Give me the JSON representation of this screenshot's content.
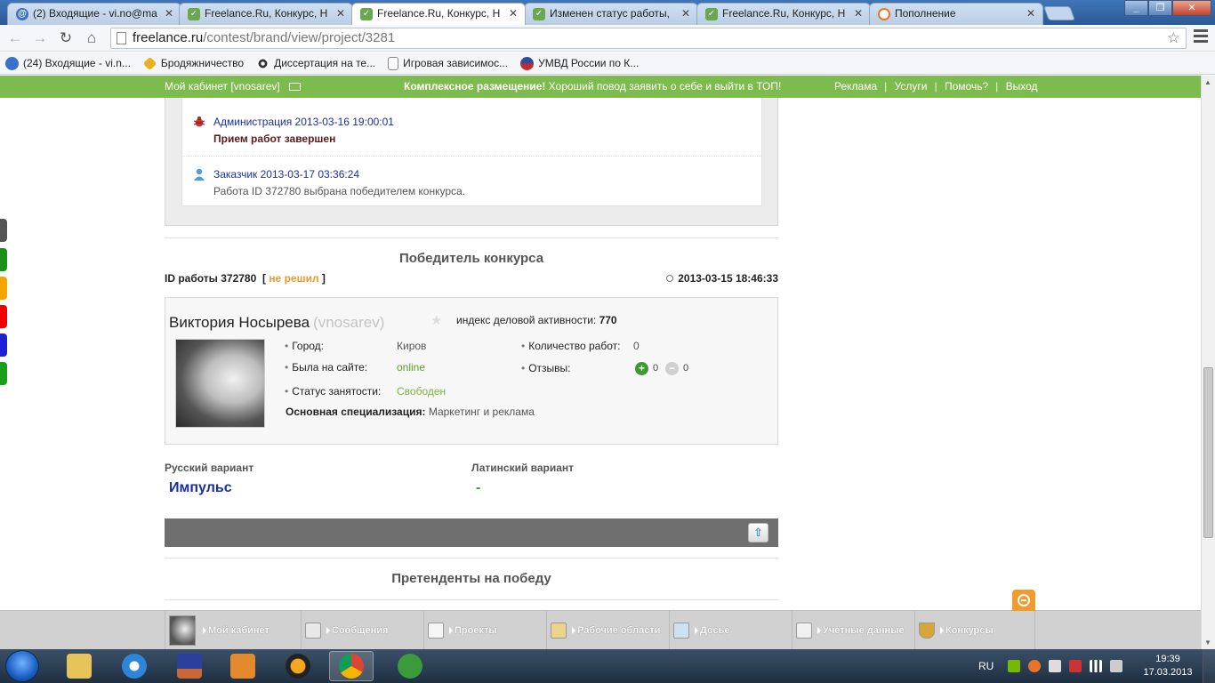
{
  "browser": {
    "tabs": [
      {
        "title": "(2) Входящие - vi.no@ma",
        "favicon": "mail-icon"
      },
      {
        "title": "Freelance.Ru, Конкурс, Н",
        "favicon": "freelance-icon"
      },
      {
        "title": "Freelance.Ru, Конкурс, Н",
        "favicon": "freelance-icon",
        "active": true
      },
      {
        "title": "Изменен статус работы,",
        "favicon": "freelance-icon"
      },
      {
        "title": "Freelance.Ru, Конкурс, Н",
        "favicon": "freelance-icon"
      },
      {
        "title": "Пополнение",
        "favicon": "q-icon"
      }
    ],
    "url_host": "freelance.ru",
    "url_path": "/contest/brand/view/project/3281",
    "bookmarks": [
      {
        "label": "(24) Входящие - vi.n...",
        "icon": "mail-icon"
      },
      {
        "label": "Бродяжничество",
        "icon": "diamond-icon"
      },
      {
        "label": "Диссертация на те...",
        "icon": "soccer-icon"
      },
      {
        "label": "Игровая зависимос...",
        "icon": "page-icon"
      },
      {
        "label": "УМВД России по К...",
        "icon": "emblem-icon"
      }
    ]
  },
  "sitebar": {
    "cabinet": "Мой кабинет [vnosarev]",
    "promo_bold": "Комплексное размещение!",
    "promo_text": " Хороший повод заявить о себе и выйти в ТОП!",
    "links": [
      "Реклама",
      "Услуги",
      "Помочь?",
      "Выход"
    ]
  },
  "events": [
    {
      "head": "Администрация 2013-03-16 19:00:01",
      "body": "Прием работ завершен"
    },
    {
      "head": "Заказчик 2013-03-17 03:36:24",
      "body": "Работа ID 372780 выбрана победителем конкурса."
    }
  ],
  "winner": {
    "section_title": "Победитель конкурса",
    "work_id_label": "ID работы 372780",
    "bracket_open": "[",
    "status": "не решил",
    "bracket_close": "]",
    "date": "2013-03-15 18:46:33",
    "name": "Виктория Носырева",
    "login": "(vnosarev)",
    "activity_label": "индекс деловой активности:",
    "activity_value": "770",
    "city_label": "Город:",
    "city": "Киров",
    "seen_label": "Была на сайте:",
    "seen": "online",
    "busy_label": "Статус занятости:",
    "busy": "Свободен",
    "spec_label": "Основная специализация:",
    "spec": "Маркетинг и реклама",
    "works_label": "Количество работ:",
    "works": "0",
    "reviews_label": "Отзывы:",
    "reviews_plus": "0",
    "reviews_minus": "0"
  },
  "variants": {
    "ru_label": "Русский вариант",
    "ru_value": "Импульс",
    "lat_label": "Латинский вариант",
    "lat_value": "-"
  },
  "contenders_title": "Претенденты на победу",
  "bottom_panel": [
    {
      "label": "Мой кабинет",
      "icon": "avatar"
    },
    {
      "label": "Сообщения",
      "icon": "envelope-icon"
    },
    {
      "label": "Проекты",
      "icon": "presentation-icon"
    },
    {
      "label": "Рабочие области",
      "icon": "workspace-icon"
    },
    {
      "label": "Досье",
      "icon": "dossier-icon"
    },
    {
      "label": "Учетные данные",
      "icon": "edit-icon"
    },
    {
      "label": "Конкурсы",
      "icon": "trophy-icon"
    }
  ],
  "taskbar": {
    "lang": "RU",
    "time": "19:39",
    "date": "17.03.2013"
  },
  "colors": {
    "site_green": "#7dbb4e",
    "link_blue": "#1a2f9c",
    "status_orange": "#e89a2e",
    "online_green": "#5c9d2c"
  }
}
